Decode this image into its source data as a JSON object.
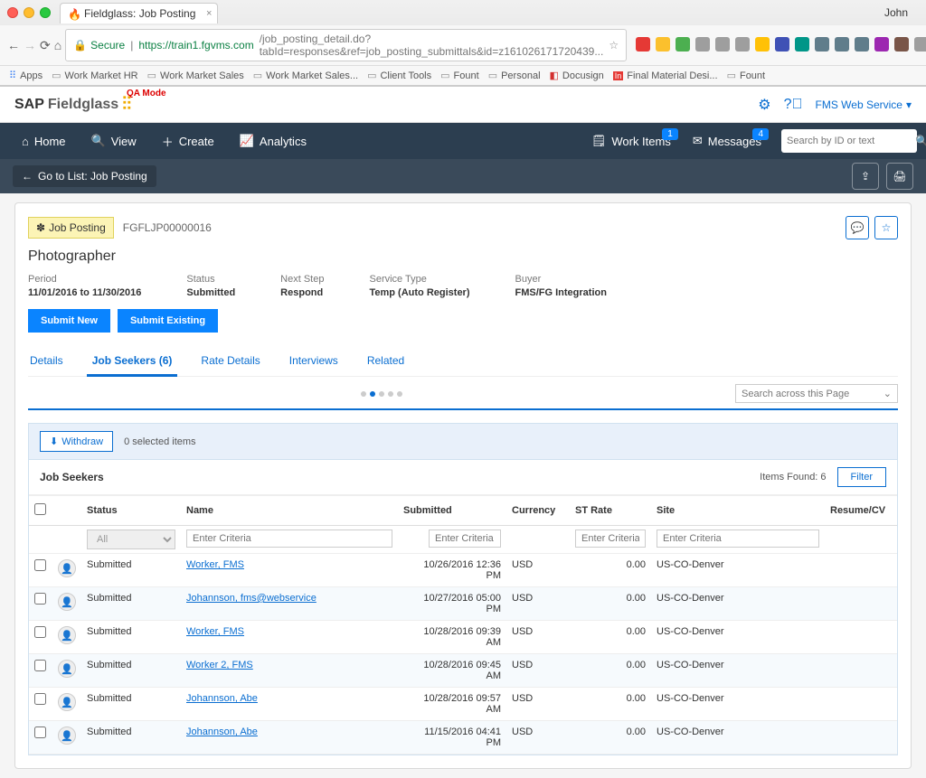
{
  "browser": {
    "tab_title": "Fieldglass: Job Posting",
    "user": "John",
    "secure_label": "Secure",
    "url_host": "https://train1.fgvms.com",
    "url_path": "/job_posting_detail.do?tabId=responses&ref=job_posting_submittals&id=z161026171720439...",
    "bookmarks": [
      "Apps",
      "Work Market HR",
      "Work Market Sales",
      "Work Market Sales...",
      "Client Tools",
      "Fount",
      "Personal",
      "Docusign",
      "Final Material Desi...",
      "Fount"
    ]
  },
  "header": {
    "logo1": "SAP",
    "logo2": "Fieldglass",
    "qa": "QA Mode",
    "fms": "FMS Web Service"
  },
  "darknav": {
    "home": "Home",
    "view": "View",
    "create": "Create",
    "analytics": "Analytics",
    "workitems": "Work Items",
    "workitems_badge": "1",
    "messages": "Messages",
    "messages_badge": "4",
    "search_ph": "Search by ID or text"
  },
  "subnav": {
    "back": "Go to List: Job Posting"
  },
  "posting": {
    "badge": "Job Posting",
    "id": "FGFLJP00000016",
    "title": "Photographer",
    "meta": {
      "period_lbl": "Period",
      "period_val": "11/01/2016 to 11/30/2016",
      "status_lbl": "Status",
      "status_val": "Submitted",
      "next_lbl": "Next Step",
      "next_val": "Respond",
      "type_lbl": "Service Type",
      "type_val": "Temp (Auto Register)",
      "buyer_lbl": "Buyer",
      "buyer_val": "FMS/FG Integration"
    },
    "btns": {
      "submit_new": "Submit New",
      "submit_existing": "Submit Existing"
    }
  },
  "tabs": {
    "details": "Details",
    "seekers": "Job Seekers (6)",
    "rate": "Rate Details",
    "interviews": "Interviews",
    "related": "Related"
  },
  "search_across_ph": "Search across this Page",
  "panel": {
    "withdraw": "Withdraw",
    "selected": "0 selected items",
    "section_title": "Job Seekers",
    "items_found": "Items Found:  6",
    "filter_btn": "Filter"
  },
  "table": {
    "headers": {
      "status": "Status",
      "name": "Name",
      "submitted": "Submitted",
      "currency": "Currency",
      "strate": "ST Rate",
      "site": "Site",
      "resume": "Resume/CV"
    },
    "filter_all": "All",
    "enter_criteria": "Enter Criteria",
    "rows": [
      {
        "status": "Submitted",
        "name": "Worker, FMS",
        "submitted": "10/26/2016 12:36 PM",
        "currency": "USD",
        "strate": "0.00",
        "site": "US-CO-Denver"
      },
      {
        "status": "Submitted",
        "name": "Johannson, fms@webservice",
        "submitted": "10/27/2016 05:00 PM",
        "currency": "USD",
        "strate": "0.00",
        "site": "US-CO-Denver"
      },
      {
        "status": "Submitted",
        "name": "Worker, FMS",
        "submitted": "10/28/2016 09:39 AM",
        "currency": "USD",
        "strate": "0.00",
        "site": "US-CO-Denver"
      },
      {
        "status": "Submitted",
        "name": "Worker 2, FMS",
        "submitted": "10/28/2016 09:45 AM",
        "currency": "USD",
        "strate": "0.00",
        "site": "US-CO-Denver"
      },
      {
        "status": "Submitted",
        "name": "Johannson, Abe",
        "submitted": "10/28/2016 09:57 AM",
        "currency": "USD",
        "strate": "0.00",
        "site": "US-CO-Denver"
      },
      {
        "status": "Submitted",
        "name": "Johannson, Abe",
        "submitted": "11/15/2016 04:41 PM",
        "currency": "USD",
        "strate": "0.00",
        "site": "US-CO-Denver"
      }
    ]
  }
}
